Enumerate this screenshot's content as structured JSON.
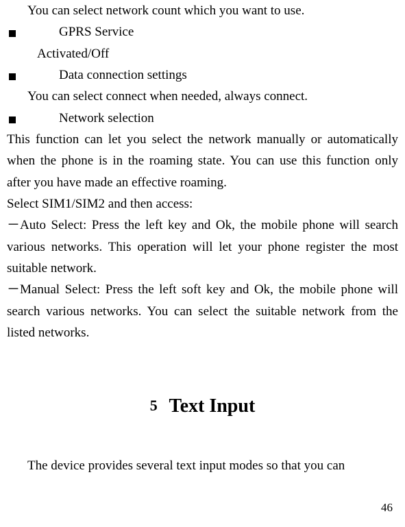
{
  "lines": {
    "intro": "You can select network count which you want to use.",
    "bullet1": "GPRS Service",
    "sub1": "Activated/Off",
    "bullet2": "Data connection settings",
    "desc2": "You can select connect when needed, always connect.",
    "bullet3": "Network selection",
    "para1": "This function can let you select the network manually or automatically when the phone is in the roaming state. You can use this function only after you have made an effective roaming.",
    "para2": "Select SIM1/SIM2 and then access:",
    "para3": "－Auto Select: Press the left key and Ok, the mobile phone will search various networks. This operation will let your phone register the most suitable network.",
    "para4": "－Manual Select: Press the left soft key and Ok, the mobile phone will search various networks. You can select the suitable network from the listed networks.",
    "chapter_num": "5",
    "chapter_title": "Text Input",
    "outro": "The device provides several text input modes so that you can"
  },
  "page_number": "46"
}
